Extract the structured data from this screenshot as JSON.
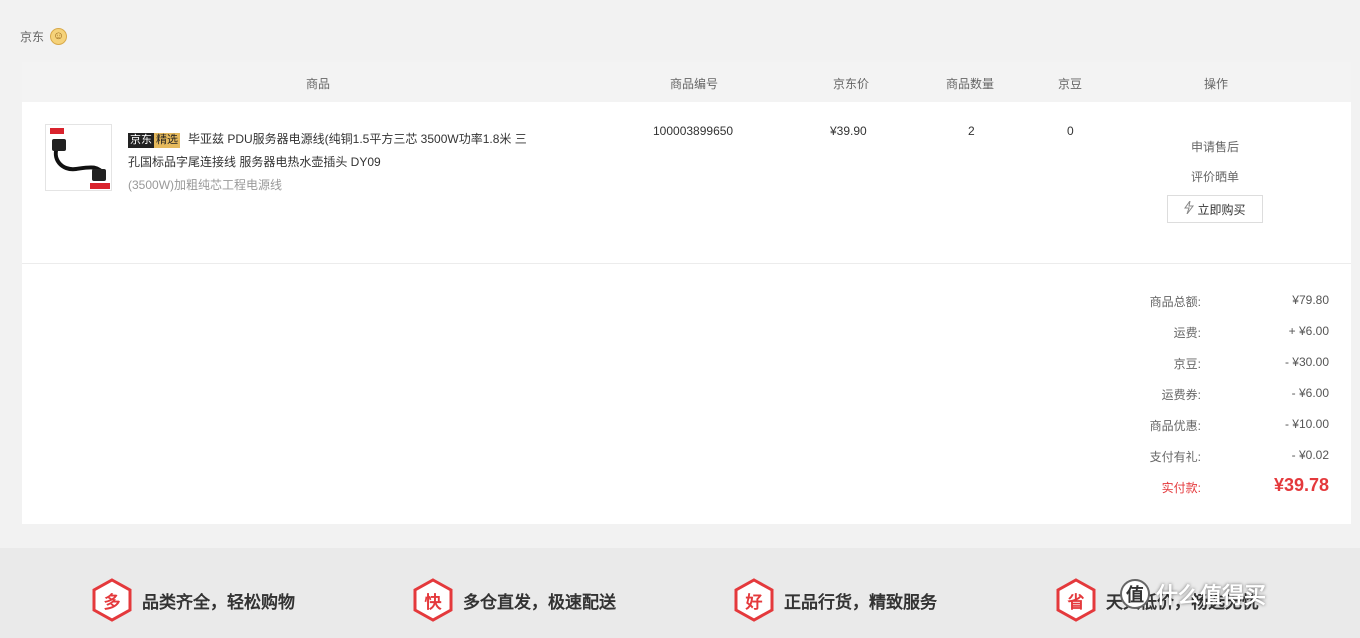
{
  "shop": {
    "name": "京东",
    "icon": "smiley-icon"
  },
  "table": {
    "headers": {
      "product": "商品",
      "sku": "商品编号",
      "price": "京东价",
      "qty": "商品数量",
      "beans": "京豆",
      "ops": "操作"
    }
  },
  "item": {
    "badge1": "京东",
    "badge2": "精选",
    "title": "毕亚兹 PDU服务器电源线(纯铜1.5平方三芯 3500W功率1.8米 三孔国标品字尾连接线 服务器电热水壶插头 DY09",
    "spec": "(3500W)加粗纯芯工程电源线",
    "sku": "100003899650",
    "price": "¥39.90",
    "qty": "2",
    "beans": "0",
    "ops": {
      "after_sale": "申请售后",
      "review": "评价晒单",
      "buy_again": "立即购买"
    }
  },
  "summary": [
    {
      "label": "商品总额:",
      "value": "¥79.80"
    },
    {
      "label": "运费:",
      "value": "+ ¥6.00"
    },
    {
      "label": "京豆:",
      "value": "- ¥30.00"
    },
    {
      "label": "运费券:",
      "value": "- ¥6.00"
    },
    {
      "label": "商品优惠:",
      "value": "- ¥10.00"
    },
    {
      "label": "支付有礼:",
      "value": "- ¥0.02"
    },
    {
      "label": "实付款:",
      "value": "¥39.78"
    }
  ],
  "promises": [
    {
      "char": "多",
      "text": "品类齐全，轻松购物"
    },
    {
      "char": "快",
      "text": "多仓直发，极速配送"
    },
    {
      "char": "好",
      "text": "正品行货，精致服务"
    },
    {
      "char": "省",
      "text": "天天低价，畅选无忧"
    }
  ],
  "watermark": {
    "logo": "值",
    "text": "什么值得买"
  },
  "colors": {
    "accent": "#e4393c",
    "badge_gold": "#e5b95c"
  }
}
